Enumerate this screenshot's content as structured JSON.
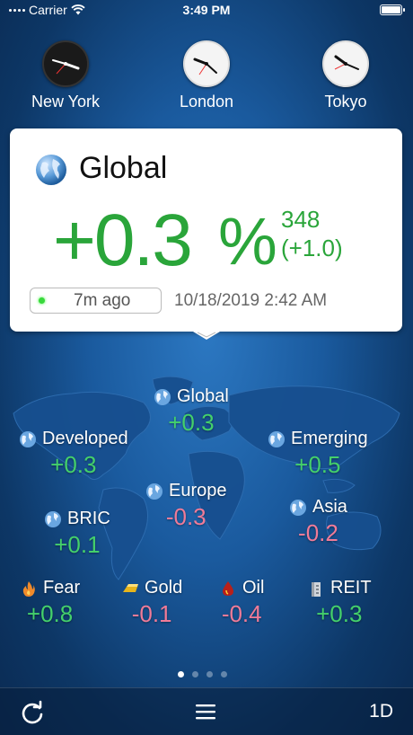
{
  "status_bar": {
    "carrier": "Carrier",
    "time": "3:49 PM"
  },
  "clocks": [
    {
      "city": "New York",
      "style": "dark"
    },
    {
      "city": "London",
      "style": "light"
    },
    {
      "city": "Tokyo",
      "style": "light"
    }
  ],
  "card": {
    "title": "Global",
    "change_percent": "+0.3",
    "percent_sign": "%",
    "points": "348",
    "points_change": "(+1.0)",
    "updated_ago": "7m ago",
    "timestamp": "10/18/2019 2:42 AM"
  },
  "markets": {
    "global": {
      "name": "Global",
      "value": "+0.3"
    },
    "developed": {
      "name": "Developed",
      "value": "+0.3"
    },
    "emerging": {
      "name": "Emerging",
      "value": "+0.5"
    },
    "europe": {
      "name": "Europe",
      "value": "-0.3"
    },
    "bric": {
      "name": "BRIC",
      "value": "+0.1"
    },
    "asia": {
      "name": "Asia",
      "value": "-0.2"
    },
    "fear": {
      "name": "Fear",
      "value": "+0.8"
    },
    "gold": {
      "name": "Gold",
      "value": "-0.1"
    },
    "oil": {
      "name": "Oil",
      "value": "-0.4"
    },
    "reit": {
      "name": "REIT",
      "value": "+0.3"
    }
  },
  "pager": {
    "total": 4,
    "active": 1
  },
  "tabbar": {
    "range_label": "1D"
  },
  "colors": {
    "positive": "#44d06b",
    "negative": "#f07b98",
    "card_positive": "#2aa53a",
    "background": "#1a5a9e"
  },
  "icons": [
    "wifi-icon",
    "battery-icon",
    "globe-icon",
    "flame-icon",
    "gold-bar-icon",
    "oil-drop-icon",
    "building-icon",
    "refresh-icon",
    "menu-icon"
  ]
}
